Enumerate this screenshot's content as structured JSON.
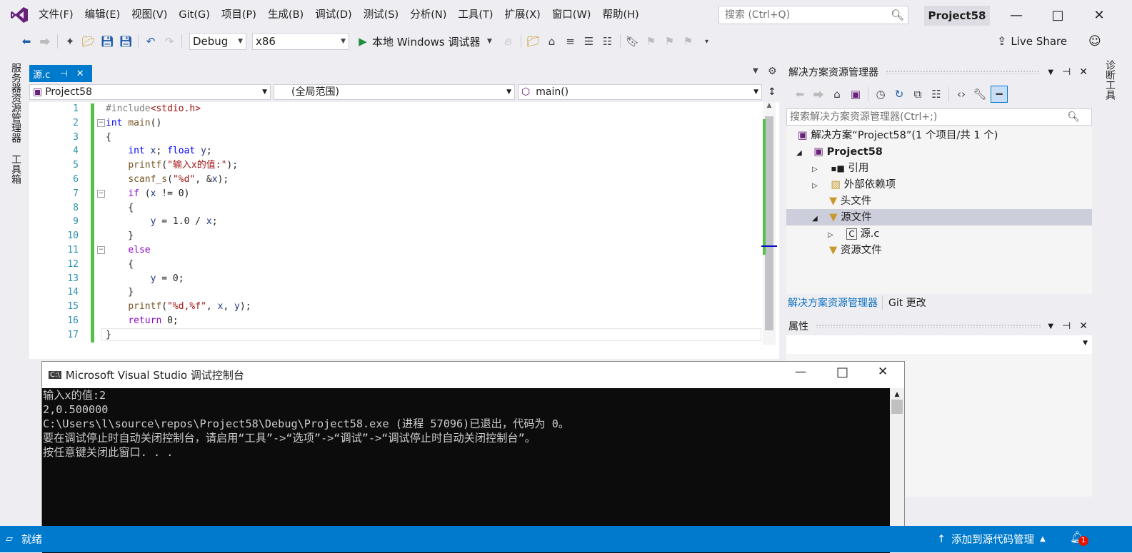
{
  "menu": [
    "文件(F)",
    "编辑(E)",
    "视图(V)",
    "Git(G)",
    "项目(P)",
    "生成(B)",
    "调试(D)",
    "测试(S)",
    "分析(N)",
    "工具(T)",
    "扩展(X)",
    "窗口(W)",
    "帮助(H)"
  ],
  "search": {
    "placeholder": "搜索 (Ctrl+Q)"
  },
  "project_badge": "Project58",
  "toolbar": {
    "config": "Debug",
    "platform": "x86",
    "run_label": "本地 Windows 调试器",
    "live_share": "Live Share"
  },
  "left_tabs": [
    "服务器资源管理器",
    "工具箱"
  ],
  "right_tabs": [
    "诊断工具"
  ],
  "editor": {
    "tab_label": "源.c",
    "nav_project": "Project58",
    "nav_scope": "(全局范围)",
    "nav_member": "main()",
    "line_numbers": [
      "1",
      "2",
      "3",
      "4",
      "5",
      "6",
      "7",
      "8",
      "9",
      "10",
      "11",
      "12",
      "13",
      "14",
      "15",
      "16",
      "17"
    ],
    "lines": [
      "#include<stdio.h>",
      "int main()",
      "{",
      "    int x; float y;",
      "    printf(\"输入x的值:\");",
      "    scanf_s(\"%d\", &x);",
      "    if (x != 0)",
      "    {",
      "        y = 1.0 / x;",
      "    }",
      "    else",
      "    {",
      "        y = 0;",
      "    }",
      "    printf(\"%d,%f\", x, y);",
      "    return 0;",
      "}"
    ]
  },
  "solution_explorer": {
    "title": "解决方案资源管理器",
    "search_placeholder": "搜索解决方案资源管理器(Ctrl+;)",
    "tree": {
      "solution": "解决方案“Project58”(1 个项目/共 1 个)",
      "project": "Project58",
      "references": "引用",
      "external_deps": "外部依赖项",
      "header_files": "头文件",
      "source_files": "源文件",
      "source_c": "源.c",
      "resource_files": "资源文件"
    },
    "tabs": [
      "解决方案资源管理器",
      "Git 更改"
    ]
  },
  "properties": {
    "title": "属性"
  },
  "console": {
    "title": "Microsoft Visual Studio 调试控制台",
    "lines": [
      "输入x的值:2",
      "2,0.500000",
      "C:\\Users\\l\\source\\repos\\Project58\\Debug\\Project58.exe (进程 57096)已退出，代码为 0。",
      "要在调试停止时自动关闭控制台，请启用“工具”->“选项”->“调试”->“调试停止时自动关闭控制台”。",
      "按任意键关闭此窗口. . ."
    ]
  },
  "status": {
    "left": "就绪",
    "source_control": "添加到源代码管理",
    "notifications": "1"
  },
  "colors": {
    "accent": "#007acc",
    "vs_purple": "#68217a",
    "change_bar": "#57c04b"
  }
}
